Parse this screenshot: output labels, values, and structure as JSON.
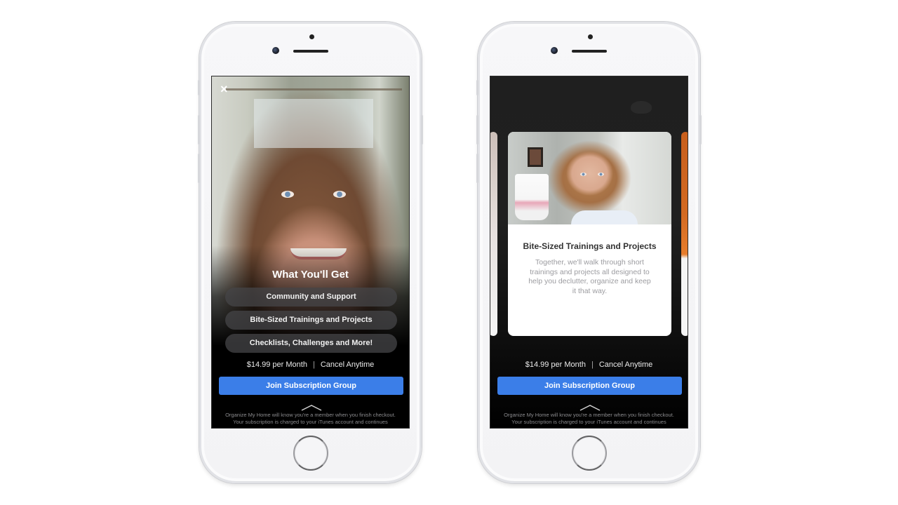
{
  "left_phone": {
    "close_icon": "×",
    "section_title": "What You'll Get",
    "features": [
      {
        "label": "Community and Support"
      },
      {
        "label": "Bite-Sized Trainings and Projects"
      },
      {
        "label": "Checklists, Challenges and More!"
      }
    ],
    "price": "$14.99 per Month",
    "separator": "|",
    "cancel_text": "Cancel Anytime",
    "join_label": "Join Subscription Group",
    "fine_print_line1": "Organize My Home will know you're a member when you finish checkout.",
    "fine_print_line2": "Your subscription is charged to your iTunes account and continues"
  },
  "right_phone": {
    "card": {
      "title": "Bite-Sized Trainings and Projects",
      "description": "Together, we'll walk through short trainings and projects all designed to help you declutter, organize and keep it that way."
    },
    "price": "$14.99 per Month",
    "separator": "|",
    "cancel_text": "Cancel Anytime",
    "join_label": "Join Subscription Group",
    "fine_print_line1": "Organize My Home will know you're a member when you finish checkout.",
    "fine_print_line2": "Your subscription is charged to your iTunes account and continues"
  },
  "colors": {
    "primary_button": "#3b7ee8",
    "screen_background": "#000000",
    "pill_background": "#464648"
  }
}
